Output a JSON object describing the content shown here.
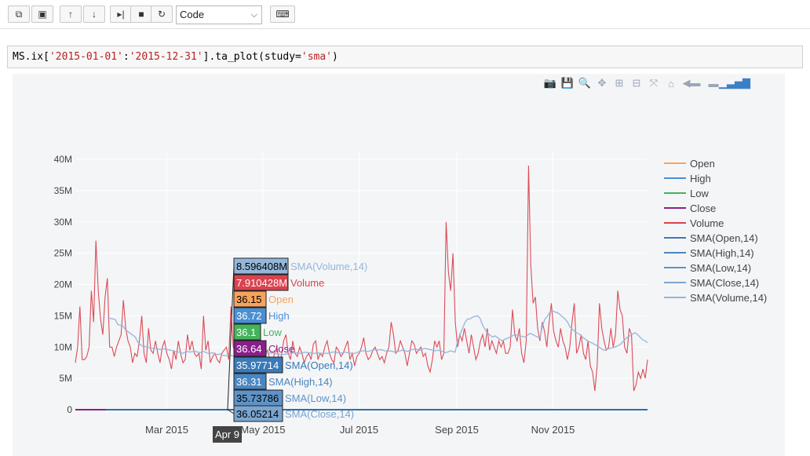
{
  "toolbar": {
    "buttons": [
      {
        "name": "copy-cells-button",
        "icon": "copy-icon",
        "glyph": "⧉"
      },
      {
        "name": "paste-cells-button",
        "icon": "paste-icon",
        "glyph": "▣"
      },
      {
        "name": "move-up-button",
        "icon": "arrow-up-icon",
        "glyph": "🡑"
      },
      {
        "name": "move-down-button",
        "icon": "arrow-down-icon",
        "glyph": "🡓"
      },
      {
        "name": "run-button",
        "icon": "step-forward-icon",
        "glyph": "▶|"
      },
      {
        "name": "interrupt-button",
        "icon": "stop-icon",
        "glyph": "■"
      },
      {
        "name": "restart-button",
        "icon": "refresh-icon",
        "glyph": "↻"
      }
    ],
    "cell_type": "Code",
    "keyboard_icon": "keyboard-icon"
  },
  "cell": {
    "prefix": "MS.ix[",
    "arg1": "'2015-01-01'",
    "colon": ":",
    "arg2": "'2015-12-31'",
    "mid": "].ta_plot(study=",
    "arg3": "'sma'",
    "suffix": ")"
  },
  "modebar_icons": [
    "camera-icon",
    "save-icon",
    "zoom-icon",
    "pan-icon",
    "zoom-in-icon",
    "zoom-out-icon",
    "autoscale-icon",
    "home-icon",
    "compare-icon",
    "spike-icon",
    "plotly-logo-icon"
  ],
  "chart_data": {
    "type": "line",
    "y_ticks": [
      "40M",
      "35M",
      "30M",
      "25M",
      "20M",
      "15M",
      "10M",
      "5M",
      "0"
    ],
    "y_tick_values": [
      40000000,
      35000000,
      30000000,
      25000000,
      20000000,
      15000000,
      10000000,
      5000000,
      0
    ],
    "x_ticks": [
      "Mar 2015",
      "May 2015",
      "Jul 2015",
      "Sep 2015",
      "Nov 2015"
    ],
    "x_tick_dates": [
      "2015-03-01",
      "2015-05-01",
      "2015-07-01",
      "2015-09-01",
      "2015-11-01"
    ],
    "x_range": [
      "2015-01-02",
      "2015-12-31"
    ],
    "ylim": [
      0,
      40000000
    ],
    "legend": [
      {
        "name": "Open",
        "color": "#f8a35c"
      },
      {
        "name": "High",
        "color": "#4a8fd4"
      },
      {
        "name": "Low",
        "color": "#45b35a"
      },
      {
        "name": "Close",
        "color": "#8a1f8a"
      },
      {
        "name": "Volume",
        "color": "#d9424e"
      },
      {
        "name": "SMA(Open,14)",
        "color": "#3a7ab8"
      },
      {
        "name": "SMA(High,14)",
        "color": "#4a86c0"
      },
      {
        "name": "SMA(Low,14)",
        "color": "#5f93c6"
      },
      {
        "name": "SMA(Close,14)",
        "color": "#7aa5cf"
      },
      {
        "name": "SMA(Volume,14)",
        "color": "#94b6d9"
      }
    ],
    "hover_date": "Apr 9",
    "hover_labels": [
      {
        "value": "8.596408M",
        "name": "SMA(Volume,14)",
        "bg": "#94b6d9",
        "fg": "#000000",
        "namecolor": "#94b6d9"
      },
      {
        "value": "7.910428M",
        "name": "Volume",
        "bg": "#d9424e",
        "fg": "#ffffff",
        "namecolor": "#d9424e"
      },
      {
        "value": "36.15",
        "name": "Open",
        "bg": "#f8a35c",
        "fg": "#000000",
        "namecolor": "#f8a35c"
      },
      {
        "value": "36.72",
        "name": "High",
        "bg": "#4a8fd4",
        "fg": "#ffffff",
        "namecolor": "#4a8fd4"
      },
      {
        "value": "36.1",
        "name": "Low",
        "bg": "#45b35a",
        "fg": "#ffffff",
        "namecolor": "#45b35a"
      },
      {
        "value": "36.64",
        "name": "Close",
        "bg": "#8a1f8a",
        "fg": "#ffffff",
        "namecolor": "#8a1f8a"
      },
      {
        "value": "35.97714",
        "name": "SMA(Open,14)",
        "bg": "#3a7ab8",
        "fg": "#ffffff",
        "namecolor": "#3a7ab8"
      },
      {
        "value": "36.31",
        "name": "SMA(High,14)",
        "bg": "#4a86c0",
        "fg": "#ffffff",
        "namecolor": "#4a86c0"
      },
      {
        "value": "35.73786",
        "name": "SMA(Low,14)",
        "bg": "#5f93c6",
        "fg": "#000000",
        "namecolor": "#5f93c6"
      },
      {
        "value": "36.05214",
        "name": "SMA(Close,14)",
        "bg": "#7aa5cf",
        "fg": "#000000",
        "namecolor": "#7aa5cf"
      }
    ],
    "series": [
      {
        "name": "Volume",
        "values": [
          7.5,
          10,
          16.5,
          8,
          8,
          8.5,
          10,
          19,
          14,
          27,
          19,
          14.5,
          12,
          18,
          21,
          10,
          10,
          8.5,
          10,
          11,
          12,
          17.5,
          13,
          11,
          10,
          7.5,
          9,
          8.5,
          11,
          15,
          9,
          7.5,
          13,
          9.5,
          9,
          11,
          9,
          7.5,
          10,
          11,
          9,
          8,
          6.5,
          9.5,
          8,
          11,
          9,
          7.5,
          8,
          12,
          9.5,
          11,
          9,
          8.5,
          9,
          6.5,
          15,
          9.5,
          11,
          7.5,
          8.5,
          9,
          8,
          7.5,
          9,
          9.5,
          10,
          8,
          16.5,
          10,
          9,
          12,
          8.5,
          9.5,
          8,
          6.5,
          7.9,
          9,
          11,
          10,
          11.5,
          9,
          8,
          9,
          9.5,
          8,
          7.5,
          9,
          10,
          8,
          8.5,
          11,
          12,
          9,
          8,
          11,
          9,
          8.5,
          10,
          9,
          7.5,
          8.5,
          9,
          8,
          10.5,
          11,
          8,
          9,
          8.5,
          10,
          11,
          9,
          8,
          7.5,
          10,
          9.5,
          8.5,
          9,
          10,
          11,
          8,
          9,
          7,
          8.5,
          9,
          10,
          11.5,
          9,
          8,
          8.5,
          9.5,
          10,
          9,
          8,
          8.5,
          7.5,
          9,
          10,
          14,
          12,
          9,
          9.5,
          11,
          10,
          9,
          7,
          9,
          11,
          10.5,
          9,
          9.5,
          10,
          8.5,
          9,
          7,
          6,
          8,
          11,
          10,
          11,
          8,
          9,
          30,
          22,
          19,
          25,
          14,
          10,
          12,
          11,
          13,
          11,
          9,
          12,
          10,
          8,
          9,
          11,
          12,
          10,
          13,
          9.5,
          11,
          10,
          9,
          11,
          10,
          11,
          9,
          9,
          10,
          16,
          12,
          11,
          13,
          9,
          7.5,
          11,
          39,
          23,
          17,
          18,
          13,
          11,
          14,
          12.5,
          10,
          14,
          17,
          12.5,
          11,
          10,
          13,
          11,
          10,
          8,
          10,
          14,
          17,
          9,
          10,
          12,
          9,
          8,
          11,
          7,
          6,
          3,
          7,
          17,
          13,
          11,
          9.5,
          10,
          13,
          10,
          12,
          19,
          16,
          15,
          10,
          9,
          13,
          12,
          3,
          4,
          6,
          5,
          6.5,
          5,
          8
        ]
      },
      {
        "name": "SMA(Volume,14)",
        "values": [
          null,
          null,
          null,
          null,
          null,
          null,
          null,
          null,
          null,
          null,
          null,
          null,
          null,
          14.6,
          14.6,
          14.5,
          14.4,
          13.6,
          13.5,
          13.4,
          12.8,
          12.5,
          12.2,
          11.9,
          11.6,
          10.8,
          10.4,
          10.1,
          10.1,
          10.0,
          9.8,
          9.8,
          9.8,
          9.7,
          9.6,
          9.7,
          9.7,
          9.6,
          9.5,
          9.4,
          9.3,
          9.2,
          9.2,
          9.0,
          9.2,
          9.3,
          9.2,
          9.3,
          9.3,
          9.2,
          9.1,
          9.3,
          9.2,
          9.0,
          9.0,
          9.1,
          8.9,
          8.8,
          8.9,
          8.7,
          8.6,
          8.7,
          8.7,
          8.6,
          8.6,
          8.6,
          8.7,
          8.8,
          8.8,
          8.9,
          9.0,
          9.1,
          9.1,
          9.2,
          9.0,
          8.9,
          9.0,
          9.1,
          9.0,
          9.1,
          8.9,
          9.0,
          8.8,
          8.8,
          8.9,
          8.9,
          9.0,
          9.1,
          9.0,
          9.1,
          9.0,
          9.1,
          9.2,
          9.1,
          9.1,
          9.0,
          9.0,
          9.1,
          9.0,
          9.0,
          9.0,
          9.0,
          9.1,
          9.2,
          9.2,
          9.1,
          9.0,
          9.1,
          9.2,
          9.1,
          9.0,
          9.0,
          9.0,
          9.2,
          9.3,
          9.4,
          9.4,
          9.3,
          9.4,
          9.5,
          9.6,
          9.5,
          9.6,
          9.5,
          9.4,
          9.3,
          9.4,
          9.3,
          9.2,
          9.3,
          9.4,
          9.5,
          9.4,
          9.3,
          9.5,
          9.6,
          9.7,
          9.6,
          9.5,
          9.7,
          9.8,
          9.7,
          9.6,
          9.5,
          9.4,
          9.5,
          9.4,
          9.3,
          9.1,
          9.2,
          9.4,
          9.3,
          9.2,
          11,
          12,
          13,
          14,
          14.5,
          14.5,
          14.8,
          14.9,
          15,
          14.6,
          13.5,
          12.8,
          12.2,
          11.9,
          11.6,
          11.8,
          11.5,
          11.2,
          11.0,
          11.3,
          11.4,
          11.6,
          11.8,
          12.0,
          11.9,
          11.8,
          11.7,
          11.6,
          11.9,
          12.2,
          12.0,
          11.8,
          11.6,
          11.5,
          13.5,
          14.5,
          15.0,
          15.6,
          15.8,
          15.6,
          15.5,
          15.2,
          14.8,
          14.5,
          14.0,
          13.2,
          12.8,
          12.5,
          12.2,
          12.0,
          11.6,
          11.3,
          11.0,
          10.8,
          10.6,
          10.4,
          10.2,
          9.9,
          9.6,
          9.5,
          9.7,
          9.8,
          9.9,
          10.0,
          10.2,
          10.4,
          10.8,
          11.2,
          11.6,
          11.8,
          12.1,
          12.3,
          12.0,
          11.6,
          11.2,
          11.0,
          10.7
        ]
      }
    ]
  }
}
